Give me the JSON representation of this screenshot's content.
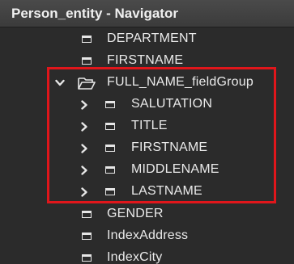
{
  "window": {
    "title": "Person_entity - Navigator"
  },
  "tree": {
    "department": {
      "label": "DEPARTMENT",
      "icon": "attribute-icon"
    },
    "firstname_top": {
      "label": "FIRSTNAME",
      "icon": "attribute-icon"
    },
    "full_name_group": {
      "label": "FULL_NAME_fieldGroup",
      "icon": "folder-open-icon",
      "expanded": true,
      "children": [
        {
          "label": "SALUTATION",
          "icon": "attribute-icon",
          "expanded": false
        },
        {
          "label": "TITLE",
          "icon": "attribute-icon",
          "expanded": false
        },
        {
          "label": "FIRSTNAME",
          "icon": "attribute-icon",
          "expanded": false
        },
        {
          "label": "MIDDLENAME",
          "icon": "attribute-icon",
          "expanded": false
        },
        {
          "label": "LASTNAME",
          "icon": "attribute-icon",
          "expanded": false
        }
      ]
    },
    "gender": {
      "label": "GENDER",
      "icon": "attribute-icon"
    },
    "index_address": {
      "label": "IndexAddress",
      "icon": "attribute-icon"
    },
    "index_city": {
      "label": "IndexCity",
      "icon": "attribute-icon"
    }
  },
  "colors": {
    "background": "#2b2b2b",
    "title_bar": "#3f3f3f",
    "text": "#eaeaea",
    "highlight": "#e0161b"
  }
}
